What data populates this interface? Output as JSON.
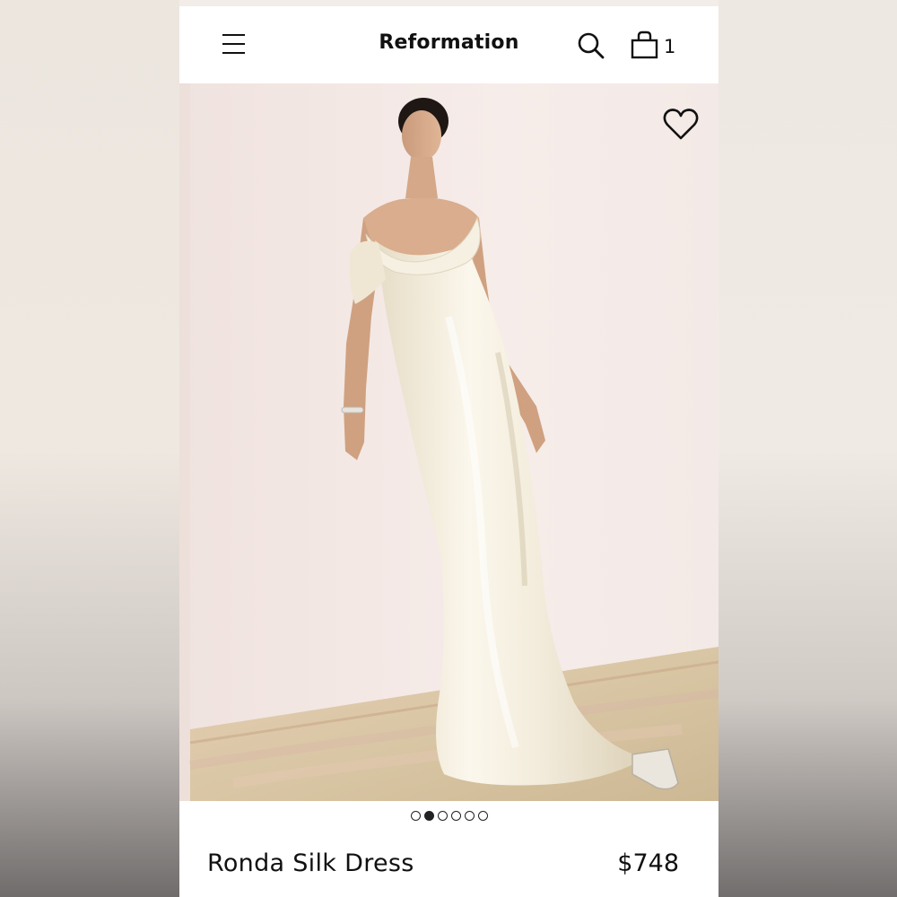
{
  "header": {
    "brand": "Reformation",
    "cart_count": "1",
    "menu_icon": "hamburger-menu-icon",
    "search_icon": "search-icon",
    "bag_icon": "shopping-bag-icon"
  },
  "gallery": {
    "wishlist_icon": "heart-outline-icon",
    "slide_count": 6,
    "active_slide": 2,
    "dress_color": "#f3eddd",
    "wall_color": "#f4eae7",
    "rug_color": "#d9c6a6"
  },
  "product": {
    "name": "Ronda Silk Dress",
    "price": "$748"
  }
}
